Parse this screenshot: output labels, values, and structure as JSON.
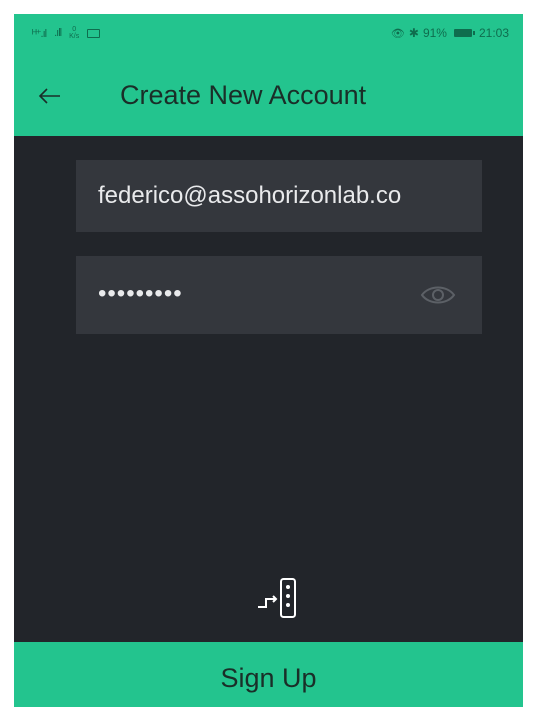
{
  "status_bar": {
    "signal1": "ᴴ⁺.ıl",
    "signal2": ".ıll",
    "speed_value": "0",
    "speed_unit": "K/s",
    "eye_glyph": "👁",
    "bluetooth_glyph": "✱",
    "battery_percent": "91%",
    "time": "21:03"
  },
  "header": {
    "title": "Create New Account"
  },
  "form": {
    "email_value": "federico@assohorizonlab.co",
    "password_value": "•••••••••"
  },
  "signup": {
    "label": "Sign Up"
  },
  "colors": {
    "accent": "#23c48e",
    "background": "#22252a",
    "field": "#34373d"
  }
}
